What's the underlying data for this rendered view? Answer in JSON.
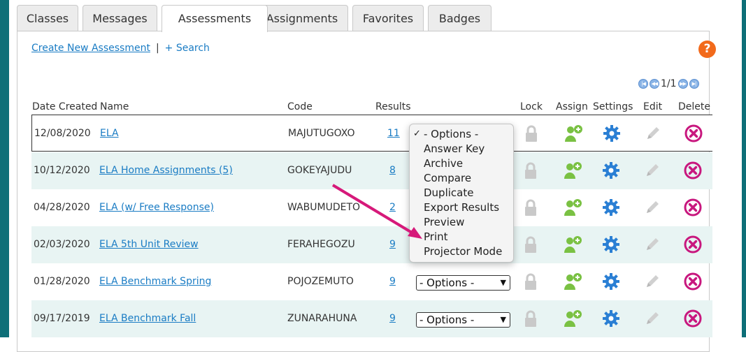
{
  "tabs": [
    "Classes",
    "Messages",
    "Assessments",
    "Assignments",
    "Favorites",
    "Badges"
  ],
  "active_tab": "Assessments",
  "links": {
    "create": "Create New Assessment",
    "separator": "|",
    "search": "+ Search"
  },
  "help": "?",
  "pager": {
    "text": "1/1"
  },
  "columns": {
    "date": "Date Created",
    "name": "Name",
    "code": "Code",
    "results": "Results",
    "lock": "Lock",
    "assign": "Assign",
    "settings": "Settings",
    "edit": "Edit",
    "delete": "Delete"
  },
  "rows": [
    {
      "date": "12/08/2020",
      "name": "ELA",
      "code": "MAJUTUGOXO",
      "results": "11"
    },
    {
      "date": "10/12/2020",
      "name": "ELA Home Assignments (5)",
      "code": "GOKEYAJUDU",
      "results": "8"
    },
    {
      "date": "04/28/2020",
      "name": "ELA (w/ Free Response)",
      "code": "WABUMUDETO",
      "results": "2"
    },
    {
      "date": "02/03/2020",
      "name": "ELA 5th Unit Review",
      "code": "FERAHEGOZU",
      "results": "9"
    },
    {
      "date": "01/28/2020",
      "name": "ELA Benchmark Spring",
      "code": "POJOZEMUTO",
      "results": "9"
    },
    {
      "date": "09/17/2019",
      "name": "ELA Benchmark Fall",
      "code": "ZUNARAHUNA",
      "results": "9"
    }
  ],
  "select": {
    "value": "- Options -"
  },
  "dropdown": {
    "selected": "- Options -",
    "items": [
      "Answer Key",
      "Archive",
      "Compare",
      "Duplicate",
      "Export Results",
      "Preview",
      "Print",
      "Projector Mode"
    ]
  },
  "colors": {
    "frame": "#0e6f78",
    "link": "#1a7cc4",
    "row_alt": "#e8f4f3",
    "assign": "#7ac143",
    "settings": "#2a7fd4",
    "delete": "#c8177e",
    "help": "#f26a1b",
    "arrow": "#d6197a"
  }
}
